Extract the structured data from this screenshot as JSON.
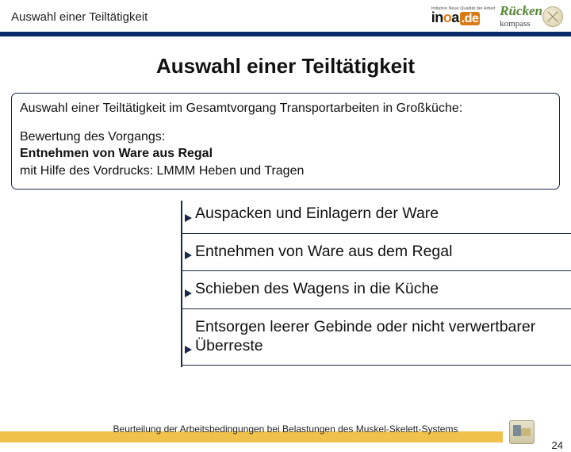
{
  "header": {
    "title": "Auswahl einer Teiltätigkeit",
    "inqa_tagline": "Initiative Neue Qualität der Arbeit",
    "inqa_name": "inoa",
    "inqa_de": ".de",
    "ruecken": "Rücken",
    "kompass": "kompass"
  },
  "main_title": "Auswahl einer Teiltätigkeit",
  "box": {
    "line1": "Auswahl einer Teiltätigkeit im Gesamtvorgang Transportarbeiten in Großküche:",
    "l2a": "Bewertung des Vorgangs:",
    "l2b": "Entnehmen von Ware aus Regal",
    "l2c": "mit Hilfe des Vordrucks: LMMM Heben und Tragen"
  },
  "steps": [
    "Auspacken und Einlagern der Ware",
    "Entnehmen von Ware aus dem Regal",
    "Schieben des Wagens in die Küche",
    "Entsorgen leerer Gebinde oder nicht verwertbarer Überreste"
  ],
  "footer": {
    "text": "Beurteilung der Arbeitsbedingungen bei Belastungen des Muskel-Skelett-Systems",
    "page": "24"
  }
}
